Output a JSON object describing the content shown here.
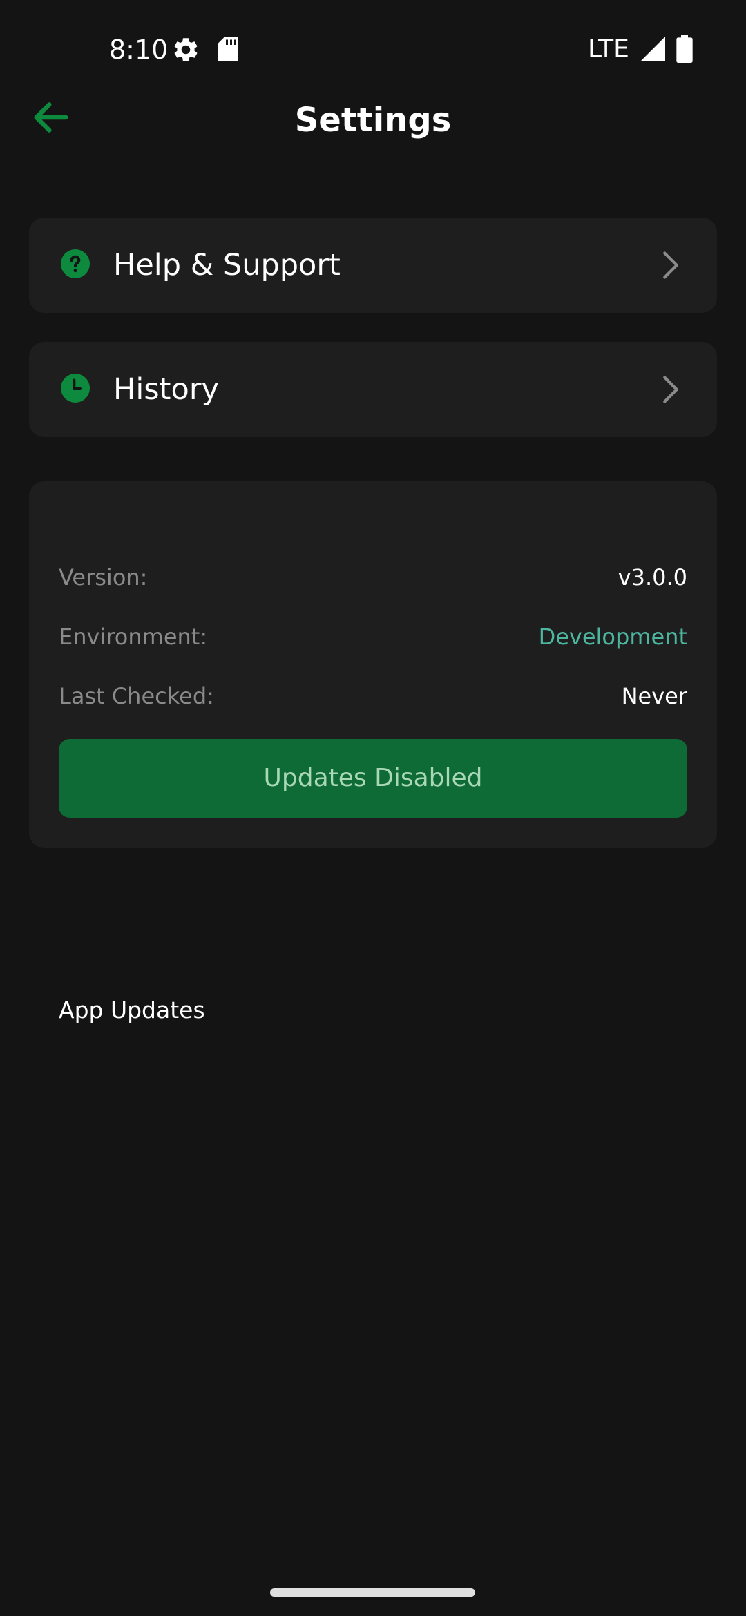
{
  "status_bar": {
    "time": "8:10",
    "network": "LTE",
    "icons": [
      "settings-gear-icon",
      "sd-card-icon",
      "signal-icon",
      "battery-icon"
    ]
  },
  "header": {
    "title": "Settings",
    "back_icon": "arrow-left-icon"
  },
  "menu": [
    {
      "label": "Help & Support",
      "icon": "help-circle-icon"
    },
    {
      "label": "History",
      "icon": "clock-icon"
    }
  ],
  "app_updates": {
    "title": "App Updates",
    "version_label": "Version:",
    "version_value": "v3.0.0",
    "environment_label": "Environment:",
    "environment_value": "Development",
    "last_checked_label": "Last Checked:",
    "last_checked_value": "Never",
    "button_label": "Updates Disabled"
  },
  "colors": {
    "background": "#141414",
    "card": "#1e1e1e",
    "accent_green": "#0e8a3e",
    "button_green": "#0e6b35",
    "environment_teal": "#4db6a0"
  }
}
